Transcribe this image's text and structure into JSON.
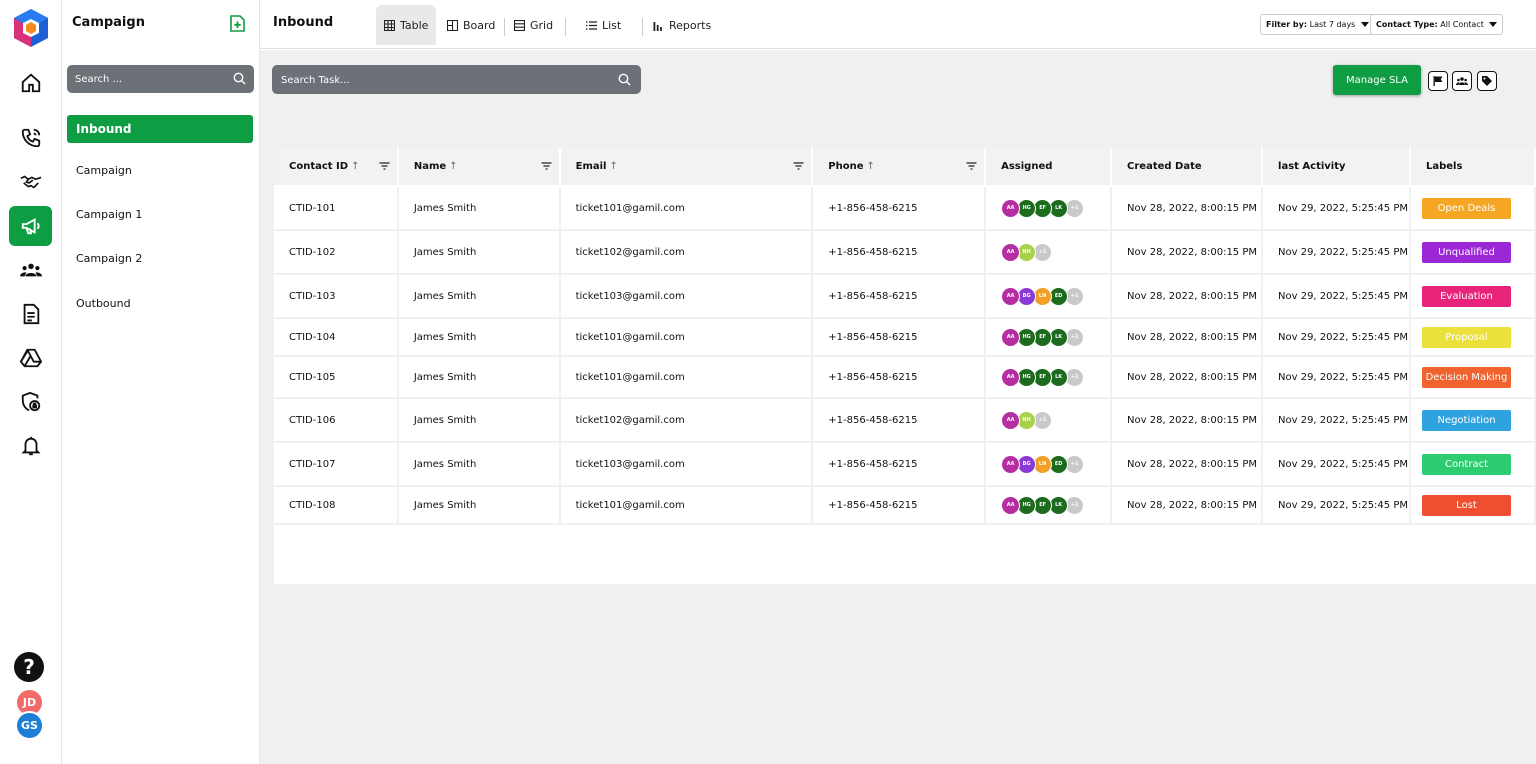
{
  "rail": {
    "avatars": [
      "JD",
      "GS"
    ]
  },
  "sidebar": {
    "title": "Campaign",
    "search_placeholder": "Search ...",
    "items": [
      {
        "label": "Inbound",
        "active": true
      },
      {
        "label": "Campaign",
        "active": false
      },
      {
        "label": "Campaign 1",
        "active": false
      },
      {
        "label": "Campaign 2",
        "active": false
      },
      {
        "label": "Outbound",
        "active": false
      }
    ]
  },
  "header": {
    "title": "Inbound",
    "tabs": [
      {
        "label": "Table",
        "icon": "table-icon",
        "active": true
      },
      {
        "label": "Board",
        "icon": "board-icon",
        "active": false
      },
      {
        "label": "Grid",
        "icon": "grid-icon",
        "active": false
      },
      {
        "label": "List",
        "icon": "list-icon",
        "active": false
      },
      {
        "label": "Reports",
        "icon": "reports-icon",
        "active": false
      }
    ],
    "filter_by_label": "Filter by:",
    "filter_by_value": "Last 7 days",
    "contact_type_label": "Contact Type:",
    "contact_type_value": "All Contact"
  },
  "toolbar": {
    "task_search_placeholder": "Search Task...",
    "manage_sla_label": "Manage SLA"
  },
  "table": {
    "columns": [
      "Contact ID",
      "Name",
      "Email",
      "Phone",
      "Assigned",
      "Created Date",
      "last Activity",
      "Labels"
    ],
    "rows": [
      {
        "id": "CTID-101",
        "name": "James Smith",
        "email": "ticket101@gamil.com",
        "phone": "+1-856-458-6215",
        "assigned": [
          "AA",
          "HG",
          "EF",
          "LK",
          "+1"
        ],
        "created": "Nov 28, 2022, 8:00:15 PM",
        "activity": "Nov 29, 2022, 5:25:45 PM",
        "label": "Open Deals",
        "label_color": "#f5a623"
      },
      {
        "id": "CTID-102",
        "name": "James Smith",
        "email": "ticket102@gamil.com",
        "phone": "+1-856-458-6215",
        "assigned": [
          "AA",
          "NH",
          "+1"
        ],
        "created": "Nov 28, 2022, 8:00:15 PM",
        "activity": "Nov 29, 2022, 5:25:45 PM",
        "label": "Unqualified",
        "label_color": "#9b27d6"
      },
      {
        "id": "CTID-103",
        "name": "James Smith",
        "email": "ticket103@gamil.com",
        "phone": "+1-856-458-6215",
        "assigned": [
          "AA",
          "BG",
          "LN",
          "ED",
          "+1"
        ],
        "created": "Nov 28, 2022, 8:00:15 PM",
        "activity": "Nov 29, 2022, 5:25:45 PM",
        "label": "Evaluation",
        "label_color": "#e8247a"
      },
      {
        "id": "CTID-104",
        "name": "James Smith",
        "email": "ticket101@gamil.com",
        "phone": "+1-856-458-6215",
        "assigned": [
          "AA",
          "HG",
          "EF",
          "LK",
          "+1"
        ],
        "created": "Nov 28, 2022, 8:00:15 PM",
        "activity": "Nov 29, 2022, 5:25:45 PM",
        "label": "Proposal",
        "label_color": "#ece03a"
      },
      {
        "id": "CTID-105",
        "name": "James Smith",
        "email": "ticket101@gamil.com",
        "phone": "+1-856-458-6215",
        "assigned": [
          "AA",
          "HG",
          "EF",
          "LK",
          "+1"
        ],
        "created": "Nov 28, 2022, 8:00:15 PM",
        "activity": "Nov 29, 2022, 5:25:45 PM",
        "label": "Decision Making",
        "label_color": "#f0622e"
      },
      {
        "id": "CTID-106",
        "name": "James Smith",
        "email": "ticket102@gamil.com",
        "phone": "+1-856-458-6215",
        "assigned": [
          "AA",
          "NH",
          "+1"
        ],
        "created": "Nov 28, 2022, 8:00:15 PM",
        "activity": "Nov 29, 2022, 5:25:45 PM",
        "label": "Negotiation",
        "label_color": "#2fa3e0"
      },
      {
        "id": "CTID-107",
        "name": "James Smith",
        "email": "ticket103@gamil.com",
        "phone": "+1-856-458-6215",
        "assigned": [
          "AA",
          "BG",
          "LN",
          "ED",
          "+1"
        ],
        "created": "Nov 28, 2022, 8:00:15 PM",
        "activity": "Nov 29, 2022, 5:25:45 PM",
        "label": "Contract",
        "label_color": "#2ecc71"
      },
      {
        "id": "CTID-108",
        "name": "James Smith",
        "email": "ticket101@gamil.com",
        "phone": "+1-856-458-6215",
        "assigned": [
          "AA",
          "HG",
          "EF",
          "LK",
          "+1"
        ],
        "created": "Nov 28, 2022, 8:00:15 PM",
        "activity": "Nov 29, 2022, 5:25:45 PM",
        "label": "Lost",
        "label_color": "#f04e30"
      }
    ]
  },
  "colors": {
    "accent": "#0f9d43",
    "search_bg": "#6b7177",
    "avatar_colors": {
      "AA": "#b52fa3",
      "HG": "#1d6b1d",
      "EF": "#1d6b1d",
      "LK": "#1d6b1d",
      "NH": "#a8d24a",
      "BG": "#8a3bd6",
      "LN": "#f0a02a",
      "ED": "#1d6b1d",
      "+1": "#c9c9c9"
    }
  }
}
